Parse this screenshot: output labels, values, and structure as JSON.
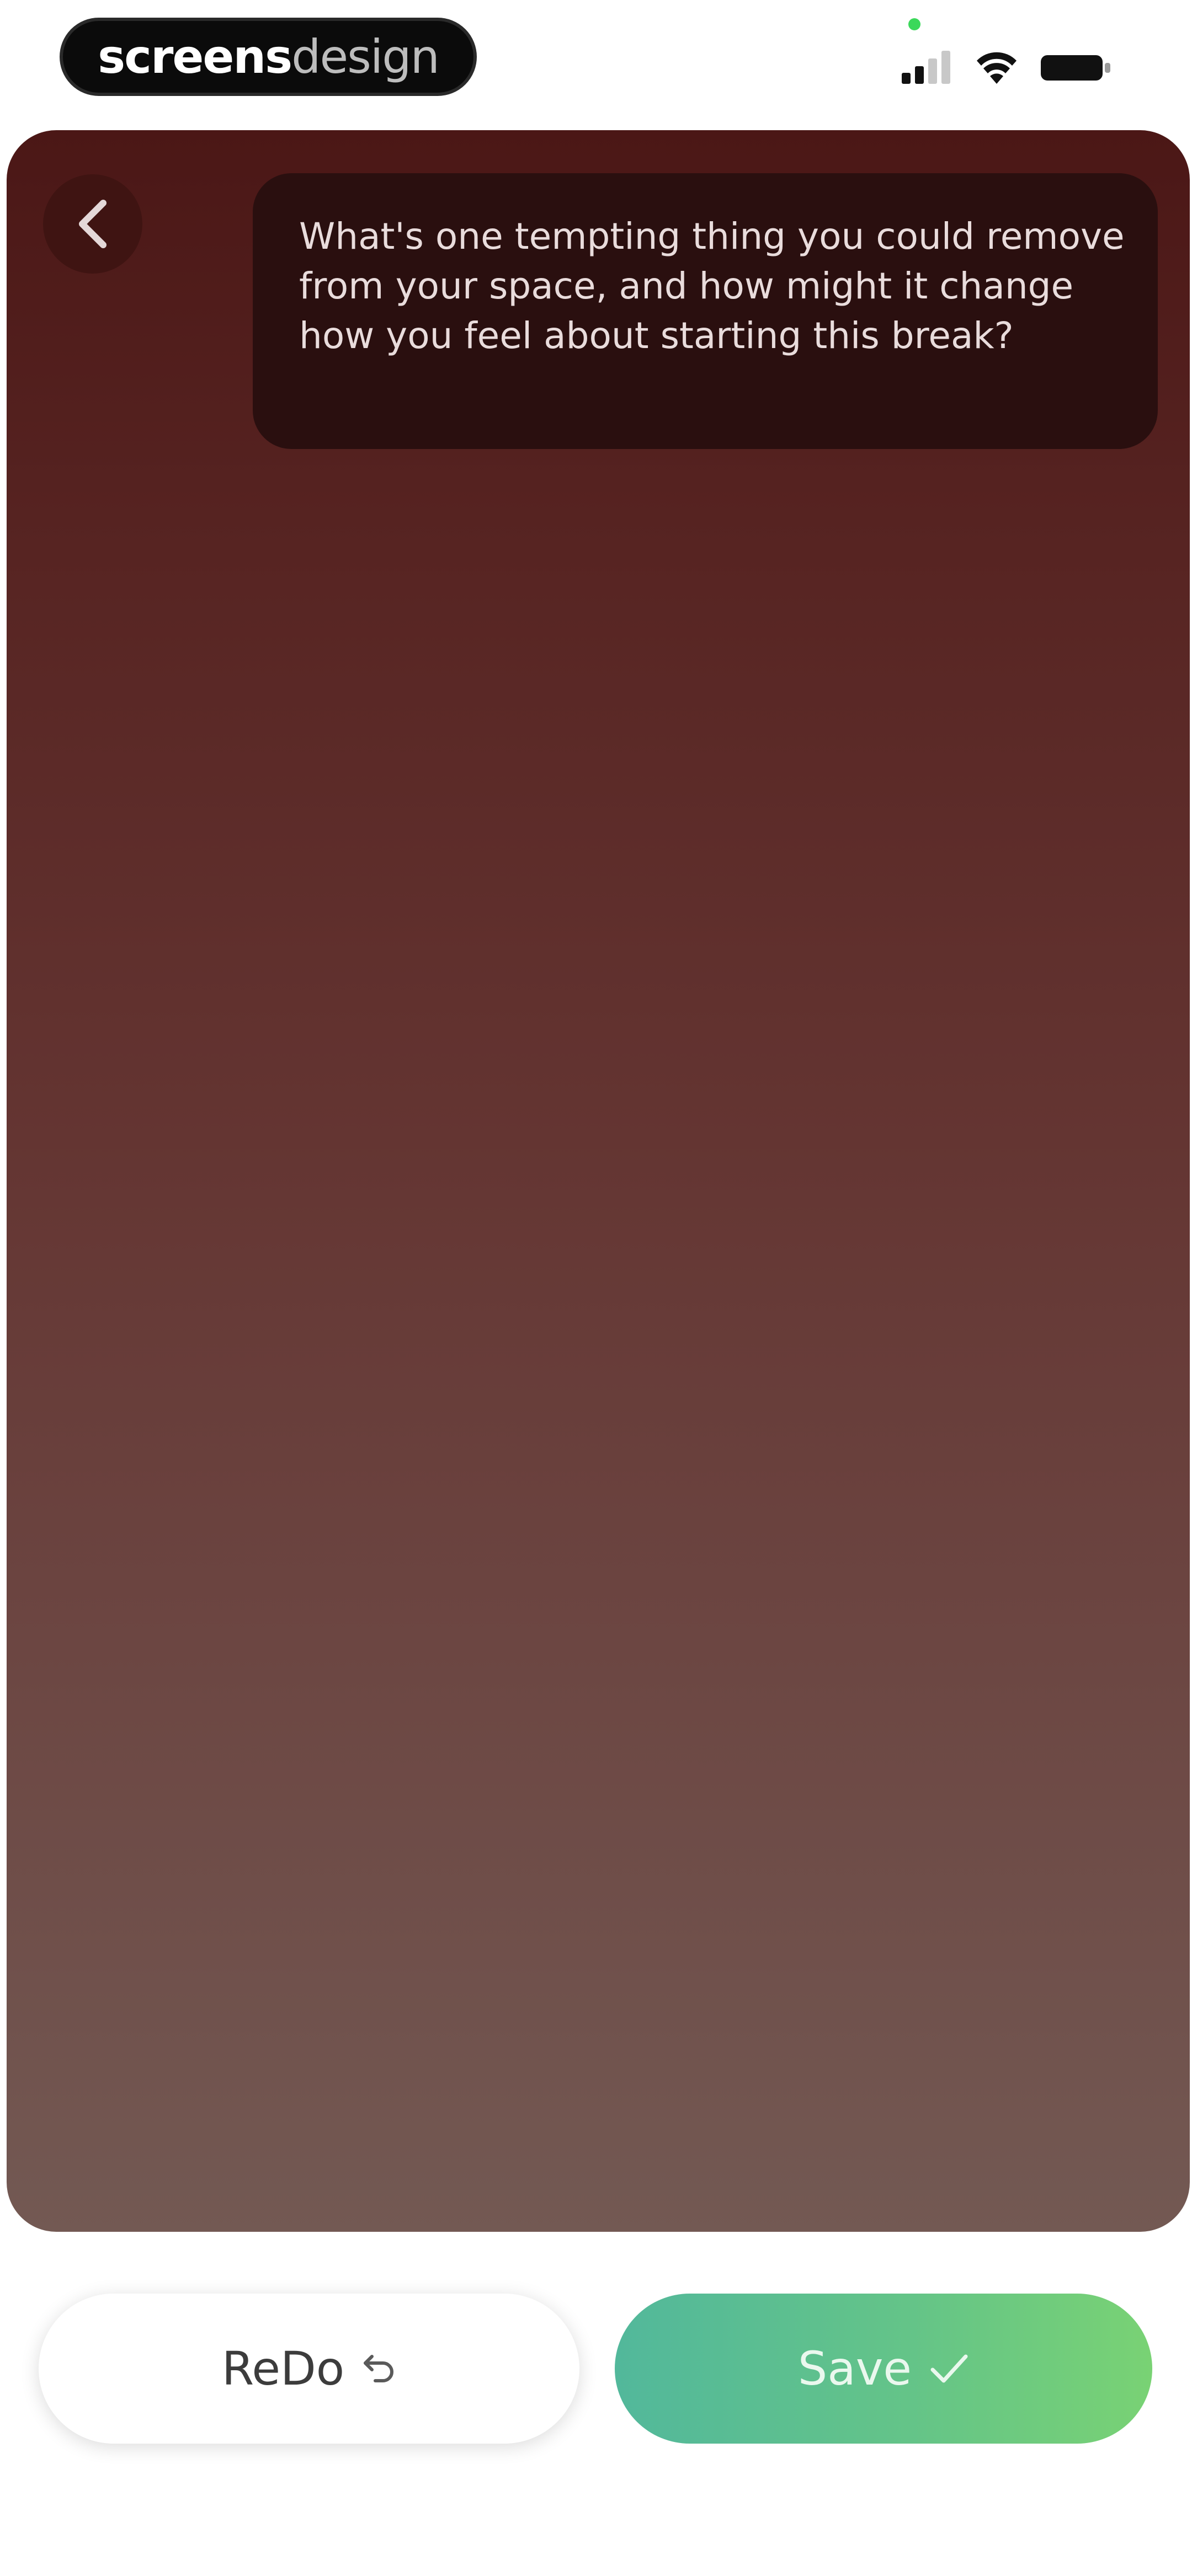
{
  "status_bar": {
    "brand_bold": "screens",
    "brand_light": "design",
    "icons": [
      "signal-icon",
      "wifi-icon",
      "battery-icon"
    ]
  },
  "card": {
    "prompt": "What's one tempting thing you could remove from your space, and how might it change how you feel about starting this break?"
  },
  "actions": {
    "redo_label": "ReDo",
    "save_label": "Save"
  },
  "colors": {
    "card_top": "#4b1716",
    "card_bottom": "#735953",
    "bubble": "#2a0f0f",
    "save_start": "#52b89b",
    "save_end": "#79d274"
  }
}
